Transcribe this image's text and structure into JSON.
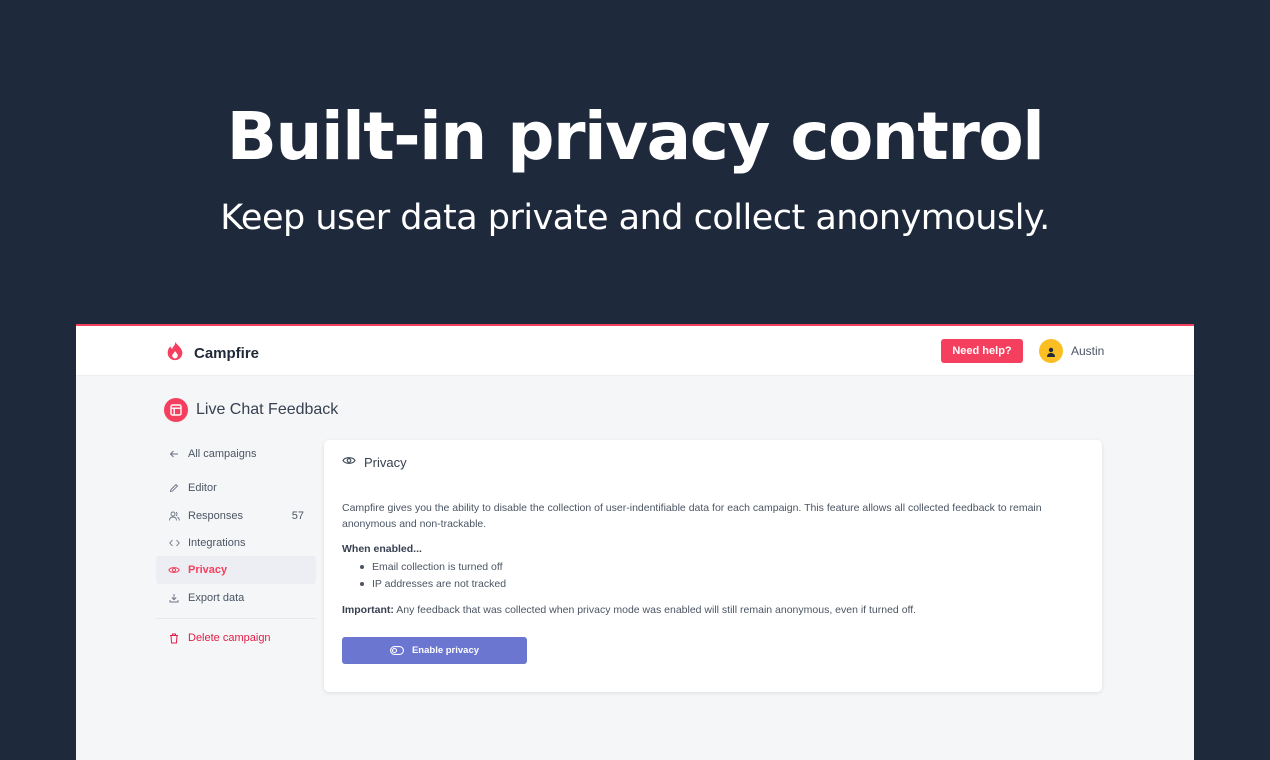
{
  "hero": {
    "title": "Built-in privacy control",
    "subtitle": "Keep user data private and collect anonymously."
  },
  "colors": {
    "background": "#1e293b",
    "accent": "#f43f5e",
    "button_primary": "#6b76d1",
    "avatar": "#fbbf24"
  },
  "topbar": {
    "brand": "Campfire",
    "help_label": "Need help?",
    "user_name": "Austin",
    "logo_icon": "flame-icon",
    "avatar_icon": "user-icon"
  },
  "page": {
    "title": "Live Chat Feedback",
    "icon": "layout-icon"
  },
  "sidebar": {
    "items": [
      {
        "label": "All campaigns",
        "icon": "arrow-left-icon"
      },
      {
        "label": "Editor",
        "icon": "pencil-icon"
      },
      {
        "label": "Responses",
        "icon": "users-icon",
        "count": "57"
      },
      {
        "label": "Integrations",
        "icon": "code-icon"
      },
      {
        "label": "Privacy",
        "icon": "eye-icon",
        "active": true
      },
      {
        "label": "Export data",
        "icon": "download-icon"
      }
    ],
    "delete_label": "Delete campaign",
    "delete_icon": "trash-icon"
  },
  "card": {
    "title": "Privacy",
    "icon": "eye-icon",
    "description": "Campfire gives you the ability to disable the collection of user-indentifiable data for each campaign. This feature allows all collected feedback to remain anonymous and non-trackable.",
    "when_label": "When enabled...",
    "bullets": [
      "Email collection is turned off",
      "IP addresses are not tracked"
    ],
    "important_label": "Important:",
    "important_text": " Any feedback that was collected when privacy mode was enabled will still remain anonymous, even if turned off.",
    "button_label": "Enable privacy",
    "button_icon": "toggle-icon"
  }
}
